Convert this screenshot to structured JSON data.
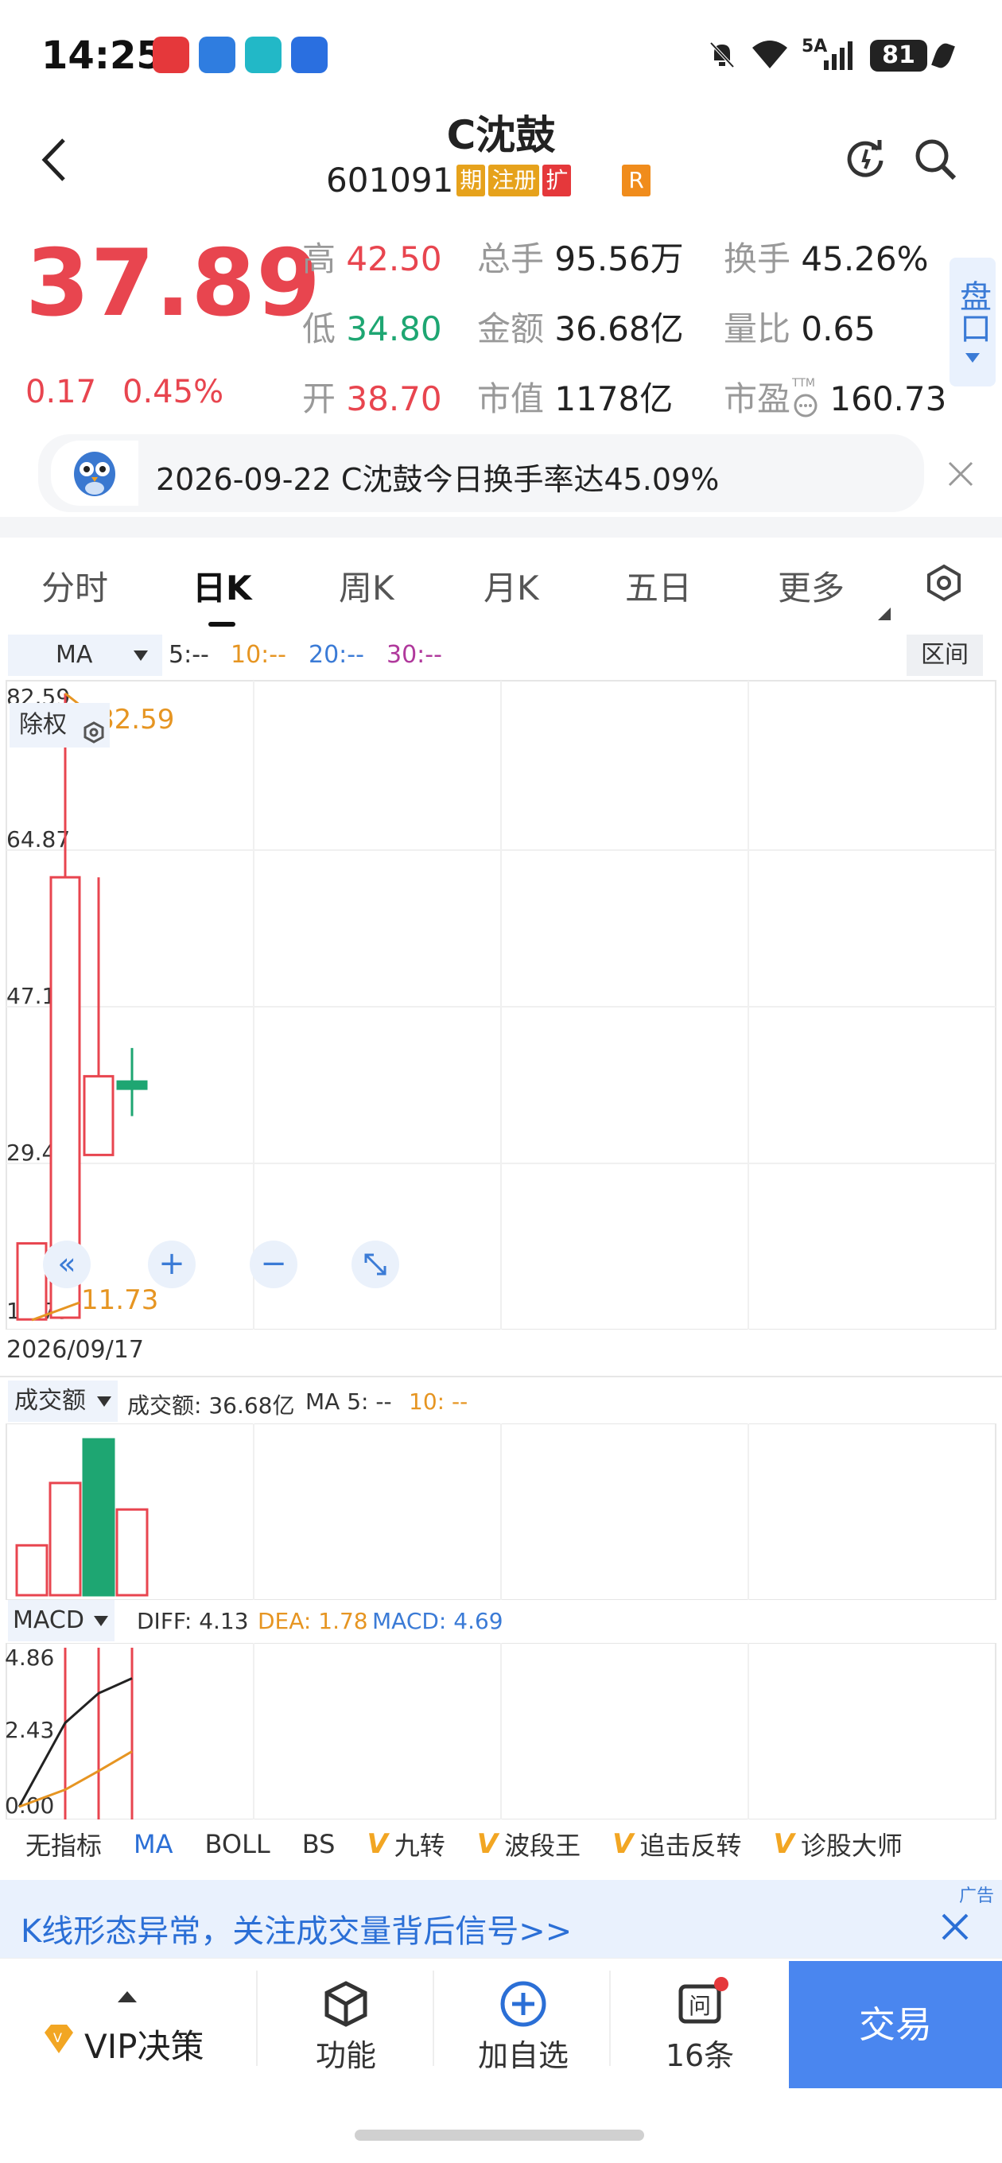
{
  "status_bar": {
    "time": "14:25",
    "signal_label": "5A",
    "battery": "81"
  },
  "header": {
    "title": "C沈鼓",
    "code": "601091",
    "badges": [
      "期",
      "注册",
      "扩"
    ],
    "r_badge": "R"
  },
  "quote": {
    "price": "37.89",
    "change": "0.17",
    "change_pct": "0.45%",
    "high_label": "高",
    "high": "42.50",
    "low_label": "低",
    "low": "34.80",
    "open_label": "开",
    "open": "38.70",
    "vol_label": "总手",
    "vol": "95.56万",
    "amount_label": "金额",
    "amount": "36.68亿",
    "mcap_label": "市值",
    "mcap": "1178亿",
    "turnover_label": "换手",
    "turnover": "45.26%",
    "ratio_label": "量比",
    "ratio": "0.65",
    "pe_label": "市盈",
    "pe_tag": "TTM",
    "pe": "160.73",
    "side_btn": "盘口"
  },
  "news": {
    "text": "2026-09-22 C沈鼓今日换手率达45.09%"
  },
  "tabs": [
    "分时",
    "日K",
    "周K",
    "月K",
    "五日",
    "更多"
  ],
  "ma_bar": {
    "select": "MA",
    "ma5": "5:--",
    "ma10": "10:--",
    "ma20": "20:--",
    "ma30": "30:--",
    "range_btn": "区间"
  },
  "chart_ctrl": {
    "fq": "除权"
  },
  "date_label": "2026/09/17",
  "vol_bar": {
    "select": "成交额",
    "amount": "成交额: 36.68亿",
    "ma5": "MA 5: --",
    "ma10": "10: --"
  },
  "macd_bar": {
    "select": "MACD",
    "diff": "DIFF: 4.13",
    "dea": "DEA: 1.78",
    "macd": "MACD: 4.69"
  },
  "indicators": [
    {
      "label": "无指标",
      "v": false
    },
    {
      "label": "MA",
      "v": false
    },
    {
      "label": "BOLL",
      "v": false
    },
    {
      "label": "BS",
      "v": false
    },
    {
      "label": "九转",
      "v": true
    },
    {
      "label": "波段王",
      "v": true
    },
    {
      "label": "追击反转",
      "v": true
    },
    {
      "label": "诊股大师",
      "v": true
    }
  ],
  "ad": {
    "text": "K线形态异常，关注成交量背后信号>>",
    "tag": "广告"
  },
  "bottom": {
    "vip": "VIP决策",
    "func": "功能",
    "add": "加自选",
    "ask": "16条",
    "trade": "交易"
  },
  "chart_data": [
    {
      "type": "candlestick",
      "title": "日K",
      "y_ticks": [
        "82.59",
        "64.87",
        "47.16",
        "29.44",
        "11.73"
      ],
      "ylim": [
        11.73,
        82.59
      ],
      "max_label": "82.59",
      "min_label": "11.73",
      "candles": [
        {
          "open": 20.4,
          "close": 11.8,
          "high": 20.4,
          "low": 11.73,
          "color": "red"
        },
        {
          "open": 12.0,
          "close": 61.8,
          "high": 82.59,
          "low": 12.0,
          "color": "red"
        },
        {
          "open": 30.4,
          "close": 39.3,
          "high": 61.8,
          "low": 30.4,
          "color": "red"
        },
        {
          "open": 38.7,
          "close": 37.89,
          "high": 42.5,
          "low": 34.8,
          "color": "green"
        }
      ]
    },
    {
      "type": "bar",
      "title": "成交额",
      "values": [
        0.32,
        0.72,
        1.0,
        0.55
      ],
      "colors": [
        "red",
        "red",
        "green",
        "red"
      ]
    },
    {
      "type": "line",
      "title": "MACD",
      "y_ticks": [
        "4.86",
        "2.43",
        "0.00"
      ],
      "ylim": [
        0,
        4.86
      ],
      "series": [
        {
          "name": "DIFF",
          "values": [
            0.0,
            2.7,
            3.65,
            4.13
          ]
        },
        {
          "name": "DEA",
          "values": [
            0.0,
            0.55,
            1.15,
            1.78
          ]
        }
      ]
    }
  ]
}
